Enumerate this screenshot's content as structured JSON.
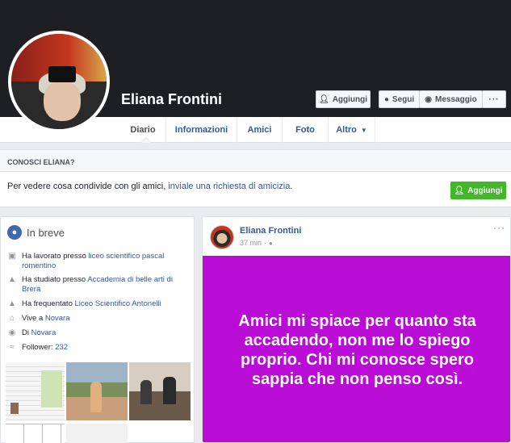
{
  "profile": {
    "name": "Eliana Frontini"
  },
  "actions": {
    "add_label": "Aggiungi",
    "follow_label": "Segui",
    "message_label": "Messaggio",
    "more_label": "···"
  },
  "tabs": [
    {
      "label": "Diario"
    },
    {
      "label": "Informazioni"
    },
    {
      "label": "Amici"
    },
    {
      "label": "Foto"
    },
    {
      "label": "Altro"
    }
  ],
  "know": {
    "title": "CONOSCI ELIANA?",
    "text_before": "Per vedere cosa condivide con gli amici, ",
    "link": "inviale una richiesta di amicizia",
    "text_after": ".",
    "button": "Aggiungi"
  },
  "intro": {
    "title": "In breve",
    "items": [
      {
        "prefix": "Ha lavorato presso ",
        "link": "liceo scientifico pascal romentino",
        "icon": "briefcase-icon"
      },
      {
        "prefix": "Ha studiato presso ",
        "link": "Accademia di belle arti di Brera",
        "icon": "graduation-cap-icon"
      },
      {
        "prefix": "Ha frequentato ",
        "link": "Liceo Scientifico Antonelli",
        "icon": "graduation-cap-icon"
      },
      {
        "prefix": "Vive a ",
        "link": "Novara",
        "icon": "home-icon"
      },
      {
        "prefix": "Di ",
        "link": "Novara",
        "icon": "location-pin-icon"
      },
      {
        "prefix": "Follower: ",
        "link": "232",
        "icon": "rss-icon"
      }
    ]
  },
  "post": {
    "author": "Eliana Frontini",
    "time": "37 min",
    "more": "···",
    "text": "Amici mi spiace per quanto sta accadendo, non me lo spiego proprio. Chi mi conosce spero sappia che non penso così.",
    "background_color": "#b90cd4"
  }
}
